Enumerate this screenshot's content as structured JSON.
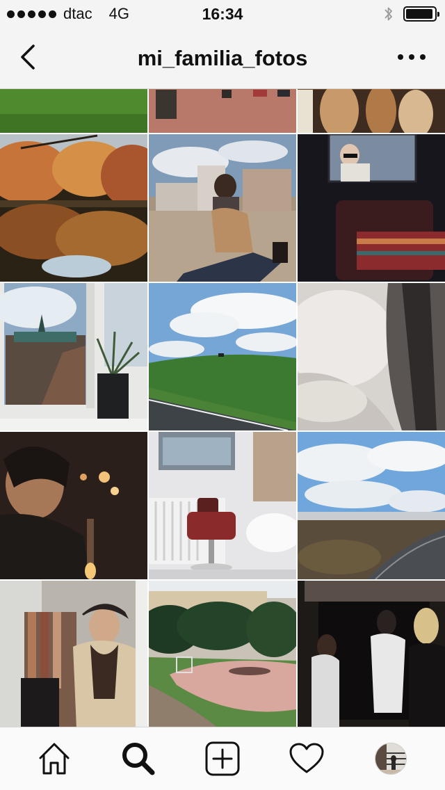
{
  "status_bar": {
    "carrier": "dtac",
    "network": "4G",
    "time": "16:34",
    "signal_dots": 5,
    "bluetooth_icon": "bluetooth-icon",
    "battery_level": 0.95
  },
  "header": {
    "title": "mi_familia_fotos",
    "back_icon": "chevron-left-icon",
    "more_icon": "more-horizontal-icon"
  },
  "tab_bar": {
    "items": [
      {
        "name": "home",
        "icon": "home-icon"
      },
      {
        "name": "search",
        "icon": "search-icon",
        "active": true
      },
      {
        "name": "new-post",
        "icon": "plus-square-icon"
      },
      {
        "name": "activity",
        "icon": "heart-icon"
      },
      {
        "name": "profile",
        "icon": "avatar"
      }
    ]
  },
  "grid": {
    "columns": 3,
    "photos": [
      {
        "id": "grass-lawn"
      },
      {
        "id": "street-feet"
      },
      {
        "id": "bread-loaves"
      },
      {
        "id": "autumn-lake"
      },
      {
        "id": "woman-camera-beach"
      },
      {
        "id": "man-sunglasses-chair"
      },
      {
        "id": "window-plant-castle"
      },
      {
        "id": "green-hill-sky"
      },
      {
        "id": "snowy-road-blur"
      },
      {
        "id": "woman-portrait-candles"
      },
      {
        "id": "barber-chair-window"
      },
      {
        "id": "landscape-clouds-road"
      },
      {
        "id": "woman-coat-shop"
      },
      {
        "id": "park-pitch-trees"
      },
      {
        "id": "people-doorway"
      }
    ]
  },
  "colors": {
    "bar_background": "#f4f4f4",
    "tab_background": "#fafafa",
    "icon": "#111111"
  }
}
